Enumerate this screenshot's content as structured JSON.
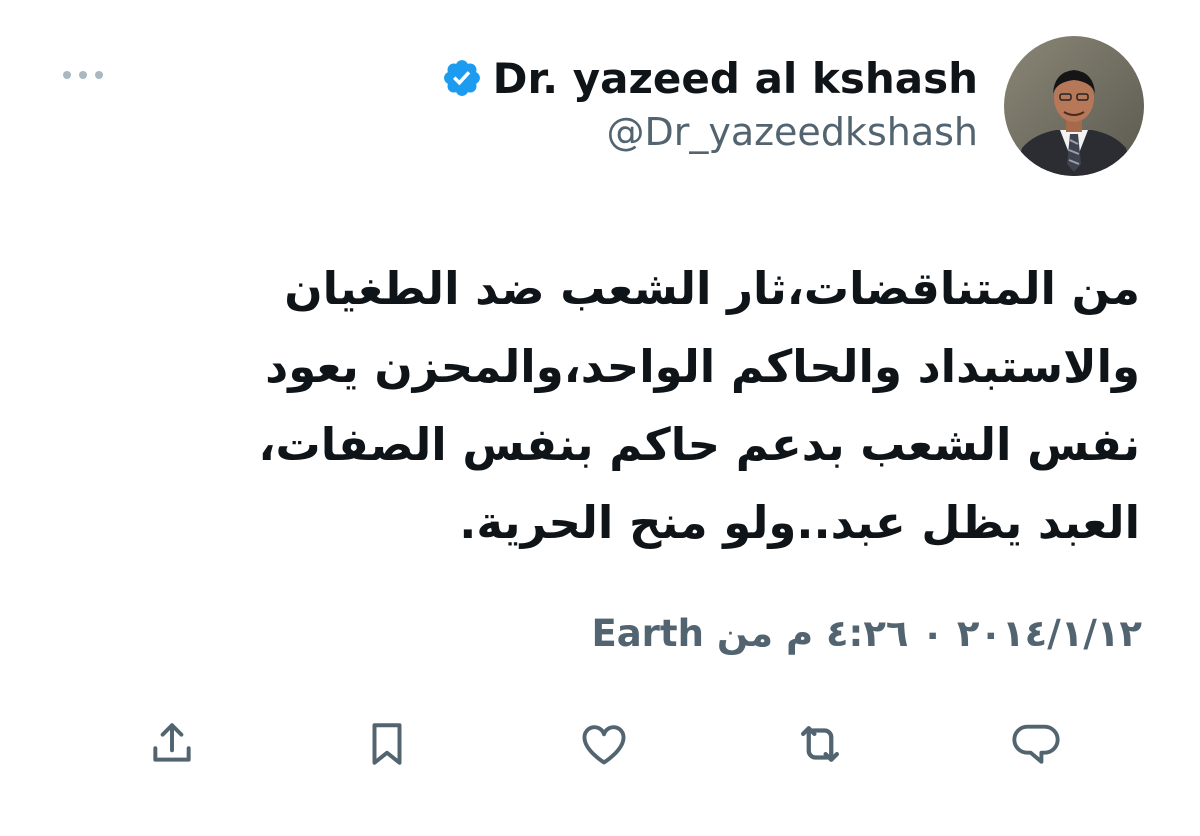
{
  "author": {
    "display_name": "Dr. yazeed al kshash",
    "handle": "@Dr_yazeedkshash",
    "verified": true
  },
  "tweet": {
    "lines": [
      "من المتناقضات،ثار الشعب ضد الطغيان",
      "والاستبداد والحاكم الواحد،والمحزن يعود",
      "نفس الشعب بدعم حاكم بنفس الصفات،",
      "العبد يظل عبد..ولو منح الحرية."
    ]
  },
  "meta": {
    "date": "٢٠١٤/١/١٢",
    "separator": "٠",
    "time": "٤:٢٦ م",
    "source_prefix": "من",
    "source": "Earth"
  },
  "icons": {
    "more": "more-dots-icon",
    "verified": "verified-badge-icon",
    "share": "share-icon",
    "bookmark": "bookmark-icon",
    "like": "heart-icon",
    "retweet": "retweet-icon",
    "reply": "reply-icon"
  },
  "colors": {
    "text_primary": "#0f1419",
    "text_secondary": "#536471",
    "verified_blue": "#1d9bf0",
    "icon_gray": "#536471",
    "more_dots": "#aab8c2"
  }
}
